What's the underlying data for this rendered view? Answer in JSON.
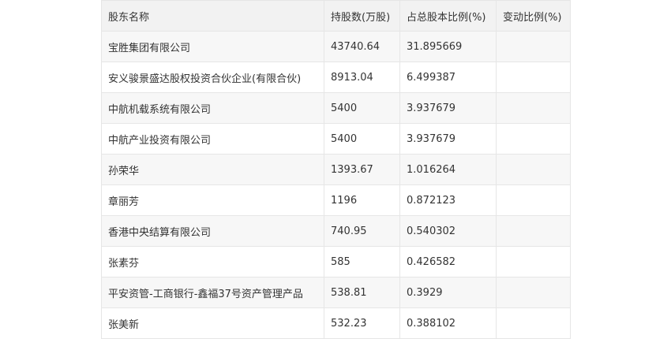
{
  "table": {
    "headers": [
      "股东名称",
      "持股数(万股)",
      "占总股本比例(%)",
      "变动比例(%)"
    ],
    "rows": [
      [
        "宝胜集团有限公司",
        "43740.64",
        "31.895669",
        ""
      ],
      [
        "安义骏景盛达股权投资合伙企业(有限合伙)",
        "8913.04",
        "6.499387",
        ""
      ],
      [
        "中航机载系统有限公司",
        "5400",
        "3.937679",
        ""
      ],
      [
        "中航产业投资有限公司",
        "5400",
        "3.937679",
        ""
      ],
      [
        "孙荣华",
        "1393.67",
        "1.016264",
        ""
      ],
      [
        "章丽芳",
        "1196",
        "0.872123",
        ""
      ],
      [
        "香港中央结算有限公司",
        "740.95",
        "0.540302",
        ""
      ],
      [
        "张素芬",
        "585",
        "0.426582",
        ""
      ],
      [
        "平安资管-工商银行-鑫福37号资产管理产品",
        "538.81",
        "0.3929",
        ""
      ],
      [
        "张美新",
        "532.23",
        "0.388102",
        ""
      ]
    ]
  }
}
